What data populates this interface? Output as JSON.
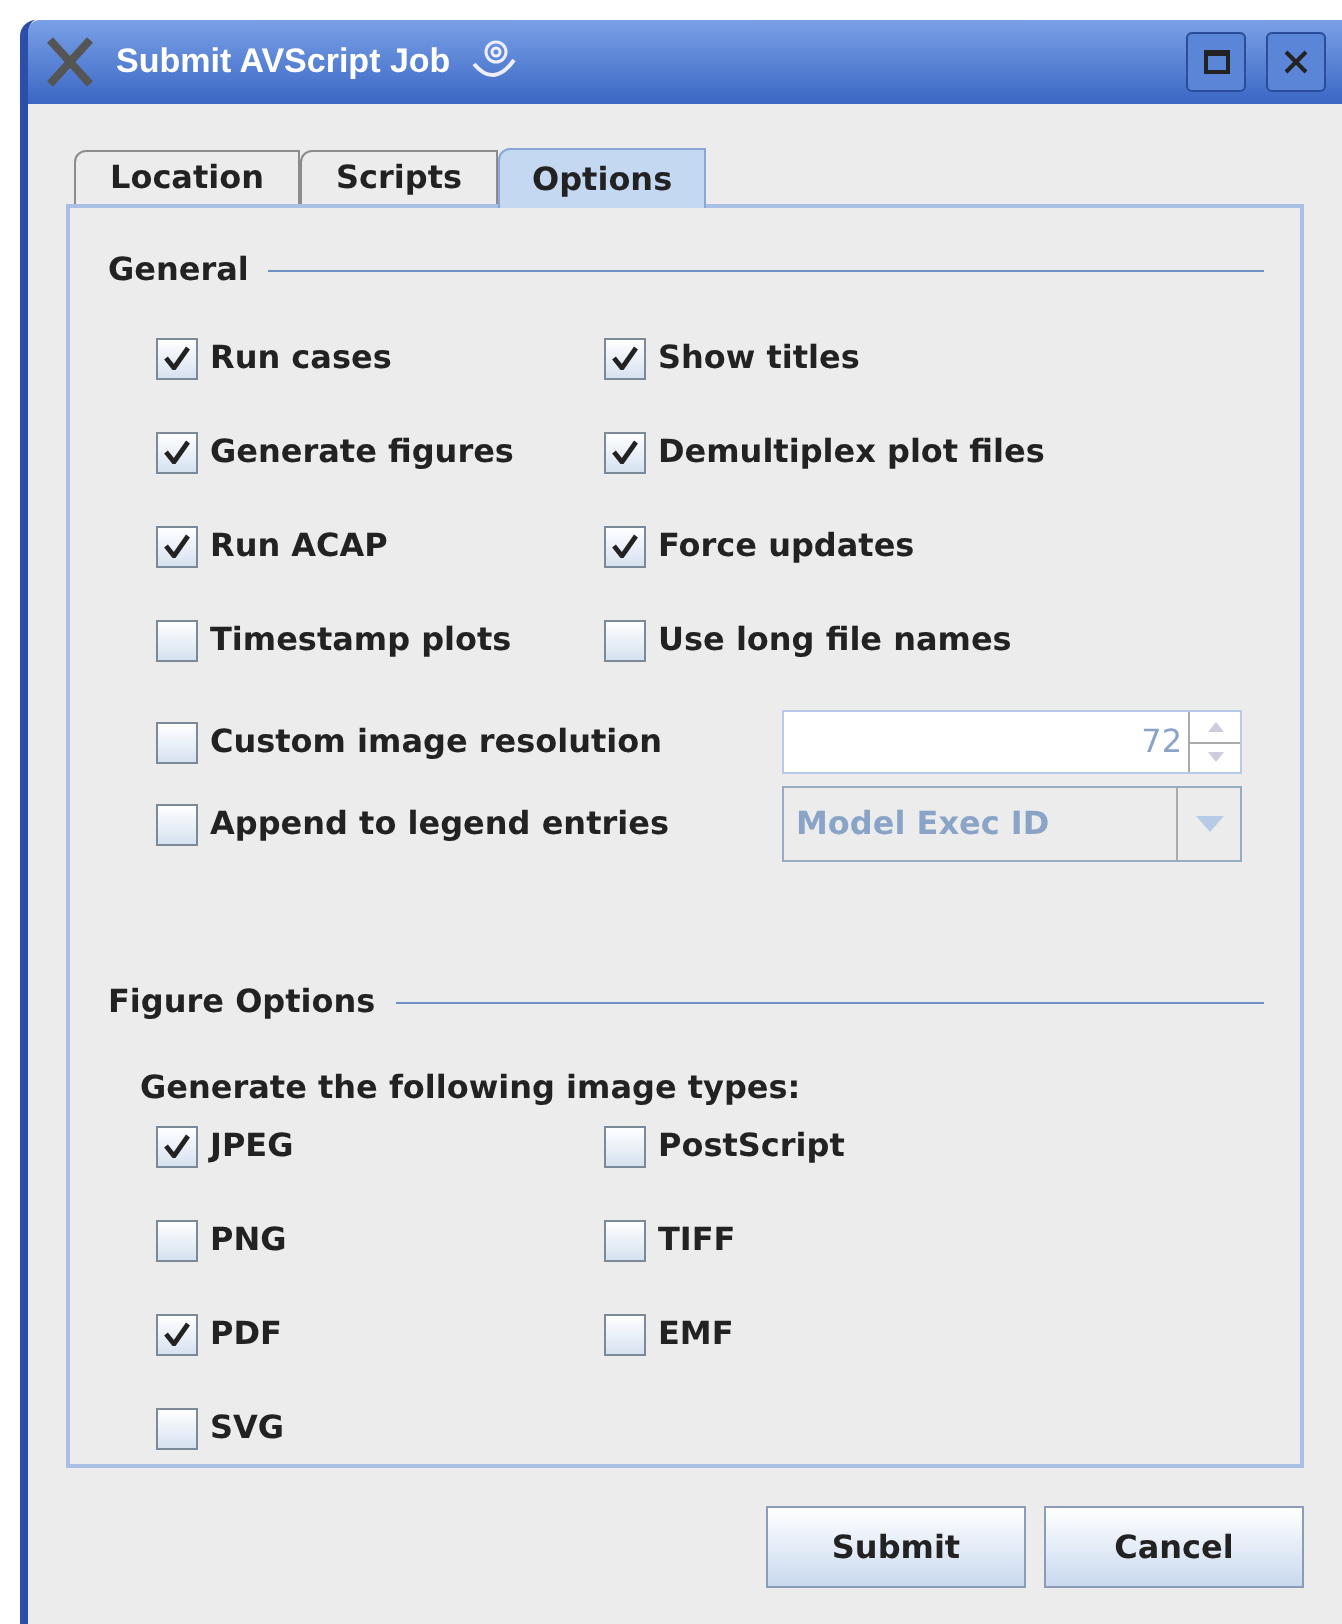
{
  "window": {
    "title": "Submit AVScript Job"
  },
  "tabs": [
    {
      "label": "Location",
      "selected": false
    },
    {
      "label": "Scripts",
      "selected": false
    },
    {
      "label": "Options",
      "selected": true
    }
  ],
  "general": {
    "heading": "General",
    "options": [
      {
        "label": "Run cases",
        "checked": true
      },
      {
        "label": "Show titles",
        "checked": true
      },
      {
        "label": "Generate figures",
        "checked": true
      },
      {
        "label": "Demultiplex plot files",
        "checked": true
      },
      {
        "label": "Run ACAP",
        "checked": true
      },
      {
        "label": "Force updates",
        "checked": true
      },
      {
        "label": "Timestamp plots",
        "checked": false
      },
      {
        "label": "Use long file names",
        "checked": false
      }
    ],
    "resolution": {
      "label": "Custom image resolution",
      "checked": false,
      "value": "72",
      "disabled": true
    },
    "legend": {
      "label": "Append to legend entries",
      "checked": false,
      "value": "Model Exec ID",
      "disabled": true
    }
  },
  "figure_options": {
    "heading": "Figure Options",
    "subtitle": "Generate the following image types:",
    "types": [
      {
        "label": "JPEG",
        "checked": true
      },
      {
        "label": "PostScript",
        "checked": false
      },
      {
        "label": "PNG",
        "checked": false
      },
      {
        "label": "TIFF",
        "checked": false
      },
      {
        "label": "PDF",
        "checked": true
      },
      {
        "label": "EMF",
        "checked": false
      },
      {
        "label": "SVG",
        "checked": false
      }
    ]
  },
  "buttons": [
    "Submit",
    "Cancel"
  ]
}
